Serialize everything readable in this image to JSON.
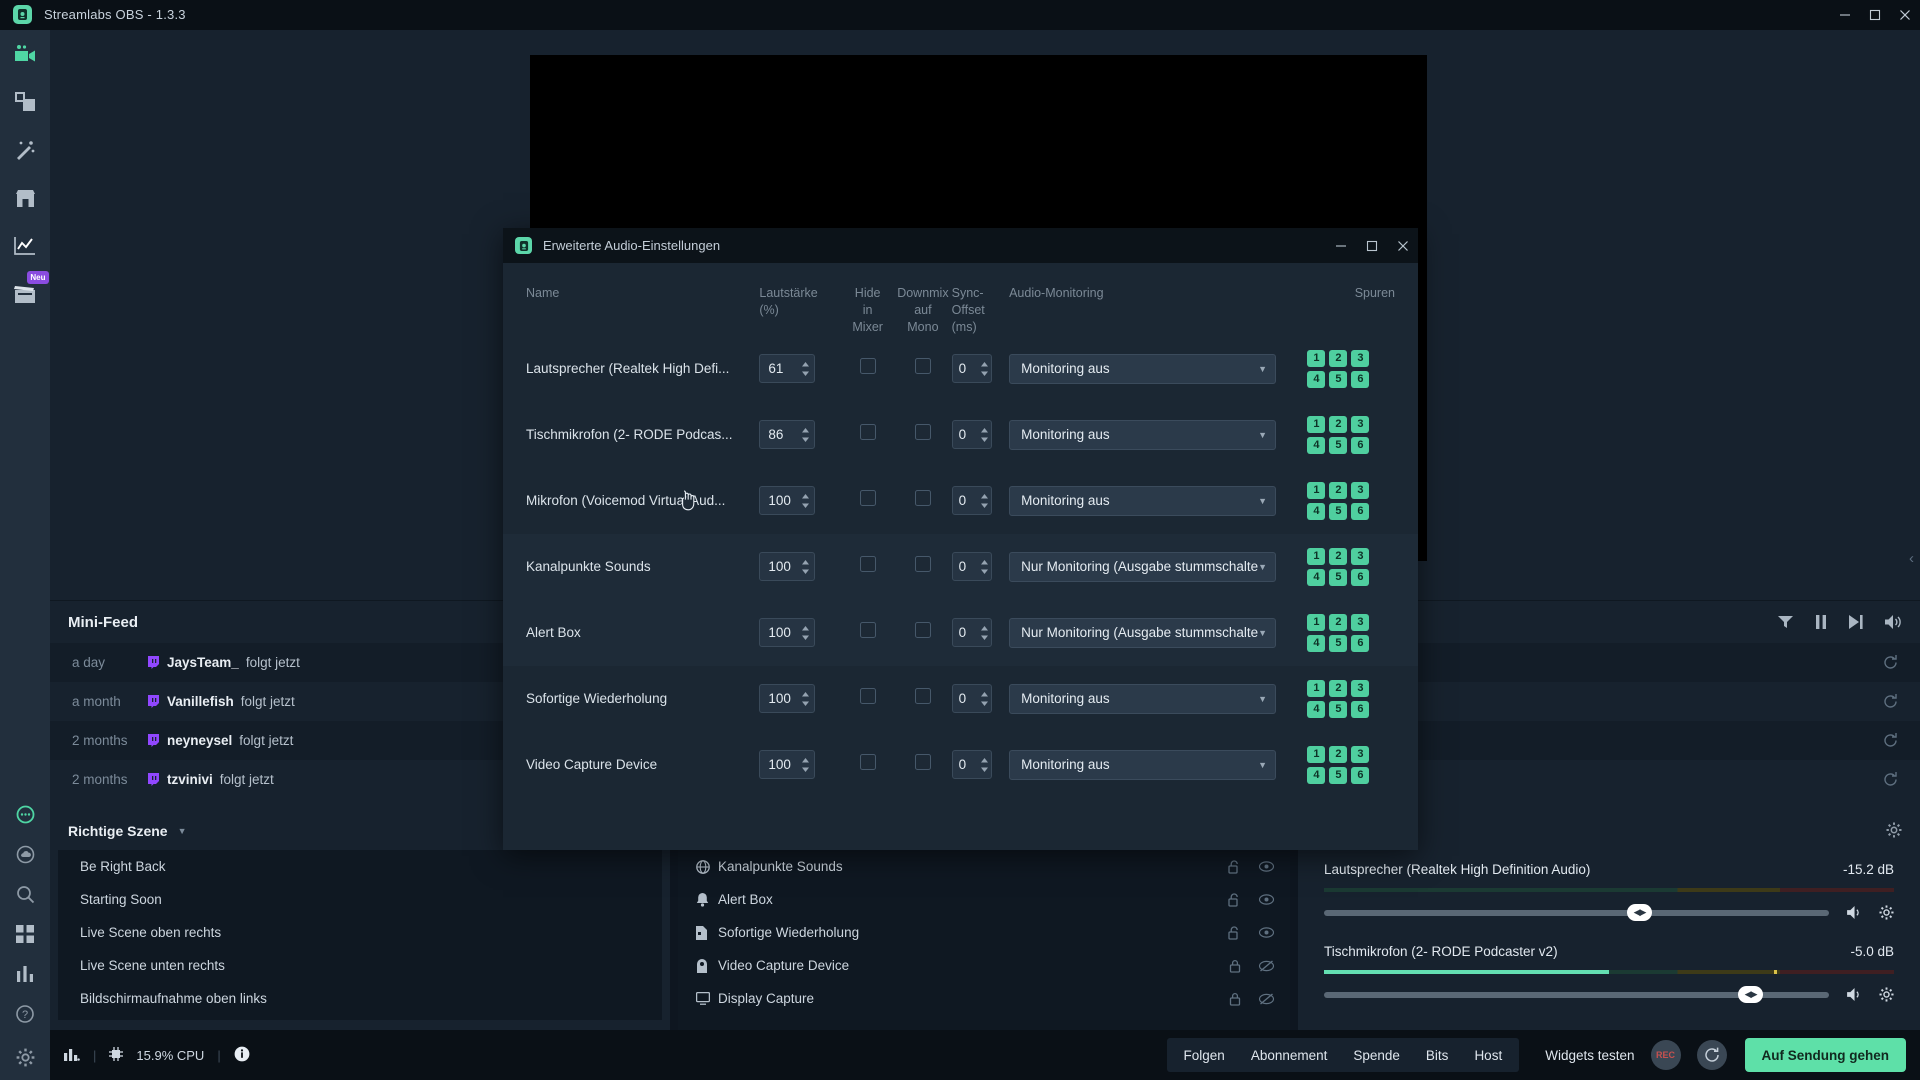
{
  "titlebar": {
    "app_title": "Streamlabs OBS - 1.3.3",
    "minimize": "−",
    "maximize": "□",
    "close": "✕"
  },
  "sidebar": {
    "items": [
      {
        "name": "editor",
        "icon": "camera-icon",
        "active": true,
        "badge": ""
      },
      {
        "name": "themes",
        "icon": "layers-icon",
        "active": false,
        "badge": ""
      },
      {
        "name": "alertbox",
        "icon": "magic-wand-icon",
        "active": false,
        "badge": ""
      },
      {
        "name": "store",
        "icon": "store-icon",
        "active": false,
        "badge": ""
      },
      {
        "name": "dashboard",
        "icon": "chart-icon",
        "active": false,
        "badge": ""
      },
      {
        "name": "highlighter",
        "icon": "clapperboard-icon",
        "active": false,
        "badge": "Neu"
      }
    ],
    "bottom": [
      {
        "name": "chat",
        "icon": "chat-bubble-icon"
      },
      {
        "name": "cloud",
        "icon": "cloud-icon"
      },
      {
        "name": "search",
        "icon": "search-icon"
      },
      {
        "name": "apps",
        "icon": "grid-icon"
      },
      {
        "name": "stats",
        "icon": "bars-icon"
      },
      {
        "name": "help",
        "icon": "question-icon"
      },
      {
        "name": "settings",
        "icon": "gear-icon"
      }
    ]
  },
  "minifeed": {
    "title": "Mini-Feed",
    "toolbar": [
      "filter-icon",
      "pause-icon",
      "skip-icon",
      "volume-icon"
    ],
    "rows": [
      {
        "time": "a day",
        "platform": "twitch-icon",
        "user": "JaysTeam_",
        "action": "folgt jetzt"
      },
      {
        "time": "a month",
        "platform": "twitch-icon",
        "user": "Vanillefish",
        "action": "folgt jetzt"
      },
      {
        "time": "2 months",
        "platform": "twitch-icon",
        "user": "neyneysel",
        "action": "folgt jetzt"
      },
      {
        "time": "2 months",
        "platform": "twitch-icon",
        "user": "tzvinivi",
        "action": "folgt jetzt"
      }
    ]
  },
  "scenes": {
    "title": "Richtige Szene",
    "items": [
      "Be Right Back",
      "Starting Soon",
      "Live Scene oben rechts",
      "Live Scene unten rechts",
      "Bildschirmaufnahme oben links"
    ]
  },
  "sources": {
    "items": [
      {
        "icon": "globe-icon",
        "name": "Kanalpunkte Sounds",
        "lock": "unlocked-icon",
        "vis": "eye-icon"
      },
      {
        "icon": "bell-icon",
        "name": "Alert Box",
        "lock": "unlocked-icon",
        "vis": "eye-icon"
      },
      {
        "icon": "file-icon",
        "name": "Sofortige Wiederholung",
        "lock": "unlocked-icon",
        "vis": "eye-icon"
      },
      {
        "icon": "camera2-icon",
        "name": "Video Capture Device",
        "lock": "locked-icon",
        "vis": "eye-off-icon"
      },
      {
        "icon": "monitor-icon",
        "name": "Display Capture",
        "lock": "locked-icon",
        "vis": "eye-off-icon"
      }
    ]
  },
  "mixer": {
    "items": [
      {
        "label": "Lautsprecher (Realtek High Definition Audio)",
        "db": "-15.2 dB",
        "level_pct": 0,
        "slider_pct": 62,
        "peak_pct": 0
      },
      {
        "label": "Tischmikrofon (2- RODE Podcaster v2)",
        "db": "-5.0 dB",
        "level_pct": 50,
        "slider_pct": 84,
        "peak_pct": 79
      }
    ]
  },
  "statusbar": {
    "cpu": "15.9% CPU",
    "chips": [
      "Folgen",
      "Abonnement",
      "Spende",
      "Bits",
      "Host"
    ],
    "widgets_label": "Widgets testen",
    "rec_label": "REC",
    "go_live": "Auf Sendung gehen"
  },
  "modal": {
    "title": "Erweiterte Audio-Einstellungen",
    "minimize": "−",
    "maximize": "□",
    "close": "✕",
    "headers": {
      "name": "Name",
      "volume": "Lautstärke\n(%)",
      "volume_l1": "Lautstärke",
      "volume_l2": "(%)",
      "hide": "Hide\nin\nMixer",
      "hide_l1": "Hide",
      "hide_l2": "in",
      "hide_l3": "Mixer",
      "downmix_l1": "Downmix",
      "downmix_l2": "auf",
      "downmix_l3": "Mono",
      "sync_l1": "Sync-",
      "sync_l2": "Offset",
      "sync_l3": "(ms)",
      "monitoring": "Audio-Monitoring",
      "tracks": "Spuren"
    },
    "track_labels": [
      "1",
      "2",
      "3",
      "4",
      "5",
      "6"
    ],
    "rows": [
      {
        "name": "Lautsprecher (Realtek High Defi...",
        "volume": "61",
        "hide": false,
        "downmix": false,
        "sync": "0",
        "monitoring": "Monitoring aus"
      },
      {
        "name": "Tischmikrofon (2- RODE Podcas...",
        "volume": "86",
        "hide": false,
        "downmix": false,
        "sync": "0",
        "monitoring": "Monitoring aus"
      },
      {
        "name": "Mikrofon (Voicemod Virtual Aud...",
        "volume": "100",
        "hide": false,
        "downmix": false,
        "sync": "0",
        "monitoring": "Monitoring aus"
      },
      {
        "name": "Kanalpunkte Sounds",
        "volume": "100",
        "hide": false,
        "downmix": false,
        "sync": "0",
        "monitoring": "Nur Monitoring (Ausgabe stummschalten)"
      },
      {
        "name": "Alert Box",
        "volume": "100",
        "hide": false,
        "downmix": false,
        "sync": "0",
        "monitoring": "Nur Monitoring (Ausgabe stummschalten)"
      },
      {
        "name": "Sofortige Wiederholung",
        "volume": "100",
        "hide": false,
        "downmix": false,
        "sync": "0",
        "monitoring": "Monitoring aus"
      },
      {
        "name": "Video Capture Device",
        "volume": "100",
        "hide": false,
        "downmix": false,
        "sync": "0",
        "monitoring": "Monitoring aus"
      }
    ]
  },
  "colors": {
    "accent": "#5ee0a8",
    "track_badge": "#4fcf9f",
    "twitch": "#9147ff",
    "panel": "#17222e",
    "modal": "#1b2733"
  }
}
